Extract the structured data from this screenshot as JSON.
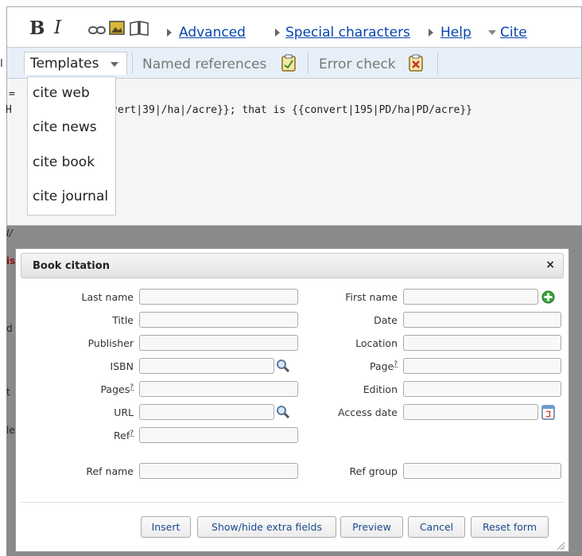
{
  "editor": {
    "outer_left_char": "I",
    "toolbar": {
      "bold_label": "B",
      "italic_label": "I",
      "link_icon": "link-icon",
      "image_icon": "embedded-file-icon",
      "reference_icon": "reference-book-icon",
      "advanced_label": "Advanced",
      "special_characters_label": "Special characters",
      "help_label": "Help",
      "cite_label": "Cite"
    },
    "subtoolbar": {
      "templates_label": "Templates",
      "named_references_label": "Named references",
      "error_check_label": "Error check"
    },
    "textarea_lines": [
      "=",
      "H      y of {{convert|39|/ha|/acre}}; that is {{convert|195|PD/ha|PD/acre}}"
    ],
    "templates_menu": [
      "cite web",
      "cite news",
      "cite book",
      "cite journal"
    ]
  },
  "background_fragments": [
    "I/",
    "is",
    "d",
    "t",
    "le"
  ],
  "dialog": {
    "title": "Book citation",
    "close_label": "×",
    "fields": {
      "last_name": {
        "label": "Last name",
        "value": ""
      },
      "first_name": {
        "label": "First name",
        "value": ""
      },
      "title": {
        "label": "Title",
        "value": ""
      },
      "date": {
        "label": "Date",
        "value": ""
      },
      "publisher": {
        "label": "Publisher",
        "value": ""
      },
      "location": {
        "label": "Location",
        "value": ""
      },
      "isbn": {
        "label": "ISBN",
        "value": ""
      },
      "page": {
        "label": "Page",
        "hint": "?",
        "value": ""
      },
      "pages": {
        "label": "Pages",
        "hint": "?",
        "value": ""
      },
      "edition": {
        "label": "Edition",
        "value": ""
      },
      "url": {
        "label": "URL",
        "value": ""
      },
      "access_date": {
        "label": "Access date",
        "value": ""
      },
      "ref": {
        "label": "Ref",
        "hint": "?",
        "value": ""
      },
      "ref_name": {
        "label": "Ref name",
        "value": ""
      },
      "ref_group": {
        "label": "Ref group",
        "value": ""
      }
    },
    "buttons": {
      "insert": "Insert",
      "show_hide": "Show/hide extra fields",
      "preview": "Preview",
      "cancel": "Cancel",
      "reset": "Reset form"
    }
  }
}
